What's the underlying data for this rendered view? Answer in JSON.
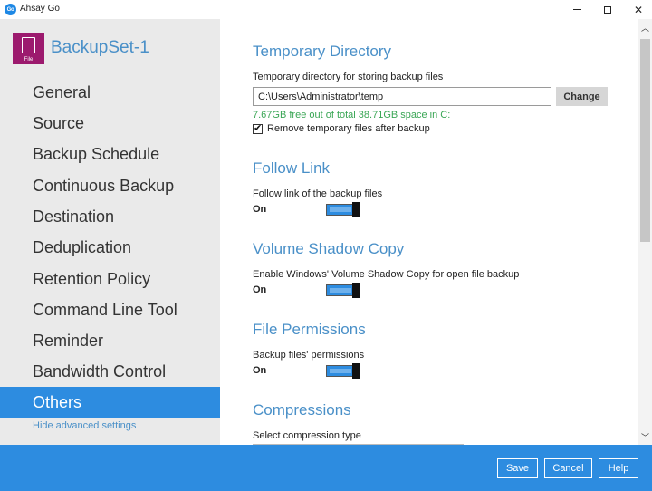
{
  "window": {
    "app_logo_text": "Go",
    "title": "Ahsay Go",
    "minimize_icon": "minimize-icon",
    "maximize_icon": "maximize-icon",
    "close_symbol": "✕"
  },
  "sidebar": {
    "set_icon_label": "File",
    "set_name": "BackupSet-1",
    "items": [
      {
        "label": "General"
      },
      {
        "label": "Source"
      },
      {
        "label": "Backup Schedule"
      },
      {
        "label": "Continuous Backup"
      },
      {
        "label": "Destination"
      },
      {
        "label": "Deduplication"
      },
      {
        "label": "Retention Policy"
      },
      {
        "label": "Command Line Tool"
      },
      {
        "label": "Reminder"
      },
      {
        "label": "Bandwidth Control"
      },
      {
        "label": "Others",
        "active": true
      }
    ],
    "hide_advanced": "Hide advanced settings"
  },
  "main": {
    "temp_dir": {
      "title": "Temporary Directory",
      "label": "Temporary directory for storing backup files",
      "value": "C:\\Users\\Administrator\\temp",
      "change_label": "Change",
      "free_space": "7.67GB free out of total 38.71GB space in C:",
      "remove_checked": true,
      "check_mark": "✔",
      "remove_label": "Remove temporary files after backup"
    },
    "follow_link": {
      "title": "Follow Link",
      "label": "Follow link of the backup files",
      "state": "On"
    },
    "vss": {
      "title": "Volume Shadow Copy",
      "label": "Enable Windows' Volume Shadow Copy for open file backup",
      "state": "On"
    },
    "file_permissions": {
      "title": "File Permissions",
      "label": "Backup files' permissions",
      "state": "On"
    },
    "compressions": {
      "title": "Compressions",
      "label": "Select compression type"
    }
  },
  "scrollbar": {
    "up_arrow": "︿",
    "down_arrow": "﹀"
  },
  "footer": {
    "save": "Save",
    "cancel": "Cancel",
    "help": "Help"
  },
  "colors": {
    "accent": "#2d8ce0",
    "section_title": "#4a90c8",
    "free_space": "#3aa655",
    "set_icon": "#9c1a6e"
  }
}
